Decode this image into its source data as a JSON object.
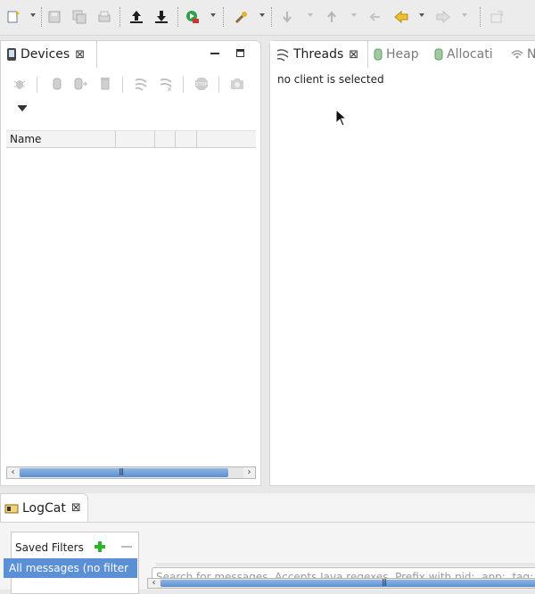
{
  "devices": {
    "tab_label": "Devices",
    "table_header": "Name",
    "toolbar_icons": [
      "debug-bug-icon",
      "update-heap-icon",
      "dump-hprof-icon",
      "cause-gc-icon",
      "update-threads-icon",
      "start-method-profiling-icon",
      "stop-process-icon",
      "screen-capture-icon"
    ],
    "view_menu_icon": "view-menu-icon"
  },
  "threads": {
    "tabs": [
      {
        "label": "Threads",
        "icon": "threads-icon",
        "active": true
      },
      {
        "label": "Heap",
        "icon": "heap-icon",
        "active": false
      },
      {
        "label": "Allocati",
        "icon": "allocation-icon",
        "active": false
      },
      {
        "label": "N",
        "icon": "network-icon",
        "active": false
      }
    ],
    "message": "no client is selected"
  },
  "logcat": {
    "tab_label": "LogCat",
    "saved_filters_label": "Saved Filters",
    "selected_filter": "All messages (no filter",
    "search_placeholder": "Search for messages. Accepts Java regexes. Prefix with pid:, app:, tag: or text: to limit scope."
  },
  "colors": {
    "selection": "#5b8fd6",
    "add_filter": "#2db42d",
    "scroll_thumb": "#5a8fd2"
  }
}
